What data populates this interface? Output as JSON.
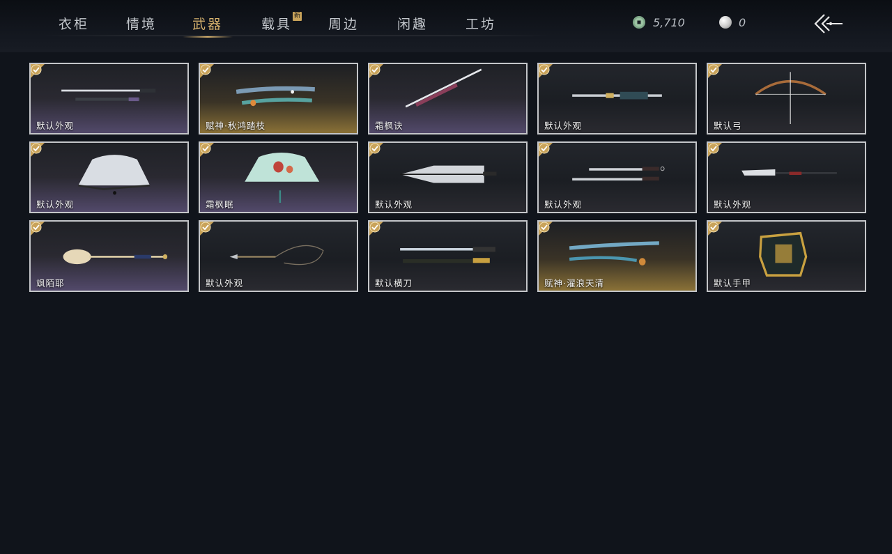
{
  "tabs": [
    {
      "label": "衣柜"
    },
    {
      "label": "情境"
    },
    {
      "label": "武器",
      "active": true
    },
    {
      "label": "载具",
      "badge": "新"
    },
    {
      "label": "周边"
    },
    {
      "label": "闲趣"
    },
    {
      "label": "工坊"
    }
  ],
  "currency": {
    "coin": {
      "icon": "jade-coin-icon",
      "value": "5,710"
    },
    "pearl": {
      "icon": "pearl-icon",
      "value": "0"
    }
  },
  "back_icon": "back-arrow-icon",
  "weapons": [
    {
      "name": "默认外观",
      "style": "purple",
      "art": "sword-pair"
    },
    {
      "name": "赋神·秋鸿踏枝",
      "style": "gold",
      "art": "spirit-blade"
    },
    {
      "name": "霜枫诀",
      "style": "purple",
      "art": "long-blade"
    },
    {
      "name": "默认外观",
      "style": "plain",
      "art": "hammer-staff"
    },
    {
      "name": "默认弓",
      "style": "plain",
      "art": "bow"
    },
    {
      "name": "默认外观",
      "style": "purple",
      "art": "fan-white"
    },
    {
      "name": "霜枫眠",
      "style": "purple",
      "art": "fan-floral"
    },
    {
      "name": "默认外观",
      "style": "plain",
      "art": "umbrella"
    },
    {
      "name": "默认外观",
      "style": "plain",
      "art": "twin-blades"
    },
    {
      "name": "默认外观",
      "style": "plain",
      "art": "glaive"
    },
    {
      "name": "飒陌耶",
      "style": "purple",
      "art": "scepter"
    },
    {
      "name": "默认外观",
      "style": "plain",
      "art": "rope-dart"
    },
    {
      "name": "默认横刀",
      "style": "plain",
      "art": "hengdao"
    },
    {
      "name": "赋神·濯浪天清",
      "style": "gold",
      "art": "spirit-blade-blue"
    },
    {
      "name": "默认手甲",
      "style": "plain",
      "art": "gauntlet"
    }
  ],
  "colors": {
    "accent": "#d8b36e",
    "check": "#c9a35a",
    "border": "#c4c6c9"
  }
}
